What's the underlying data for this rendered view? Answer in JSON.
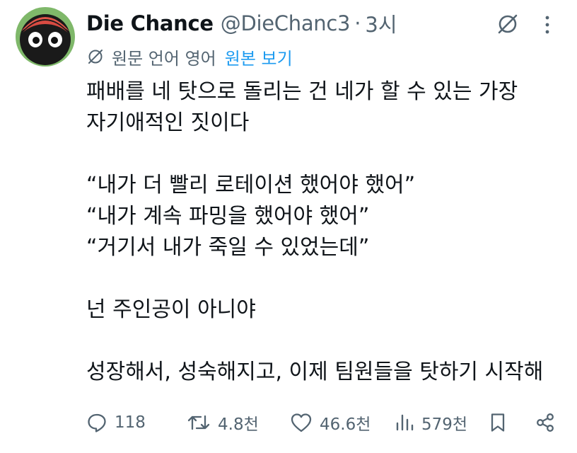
{
  "author": {
    "display_name": "Die Chance",
    "handle": "@DieChanc3",
    "separator": "·",
    "time": "3시"
  },
  "translation": {
    "note": "원문 언어 영어",
    "show_original": "원본 보기"
  },
  "tweet_lines": [
    "패배를 네 탓으로 돌리는 건 네가 할 수 있는 가장",
    "자기애적인 짓이다",
    "",
    "“내가 더 빨리 로테이션 했어야 했어”",
    "“내가 계속 파밍을 했어야 했어”",
    "“거기서 내가 죽일 수 있었는데”",
    "",
    "넌 주인공이 아니야",
    "",
    "성장해서, 성숙해지고, 이제 팀원들을 탓하기 시작해"
  ],
  "actions": {
    "replies": "118",
    "reposts": "4.8천",
    "likes": "46.6천",
    "views": "579천"
  },
  "icons": [
    "avatar",
    "grok-icon",
    "more-icon",
    "globe-icon",
    "reply-icon",
    "repost-icon",
    "like-icon",
    "views-icon",
    "bookmark-icon",
    "share-icon"
  ],
  "colors": {
    "text": "#0f1419",
    "secondary": "#536471",
    "link": "#1d9bf0"
  }
}
